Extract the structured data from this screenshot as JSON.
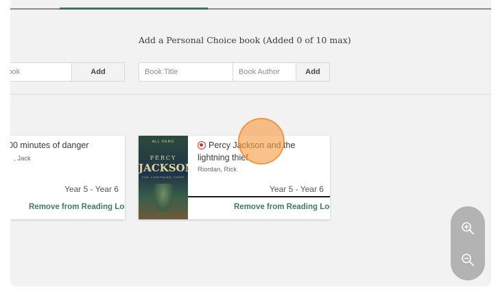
{
  "personal_choice": {
    "title": "Add a Personal Choice book (Added 0 of 10 max)",
    "title_placeholder": "Book Title",
    "author_placeholder": "Book Author",
    "add_label": "Add"
  },
  "left_form": {
    "field_placeholder": "Book",
    "add_label": "Add"
  },
  "books": [
    {
      "title": "00 minutes of danger",
      "author": ", Jack",
      "year_range": "Year 5 - Year 6",
      "remove_label": "Remove from Reading Log"
    },
    {
      "title": "Percy Jackson and the lightning thief",
      "author": "Riordan, Rick",
      "year_range": "Year 5 - Year 6",
      "remove_label": "Remove from Reading Log",
      "status_icon": "radio-record-icon",
      "cover": {
        "top": "ALL HERO",
        "line1": "PERCY",
        "line2": "JACKSON",
        "line3": "THE LIGHTNING THIEF"
      }
    }
  ],
  "zoom": {
    "zoom_in_icon": "zoom-in-icon",
    "zoom_out_icon": "zoom-out-icon"
  },
  "colors": {
    "accent": "#3f7a6c",
    "tab_indicator": "#3f6f63",
    "click_marker": "#f79c42",
    "record": "#c0392b"
  }
}
